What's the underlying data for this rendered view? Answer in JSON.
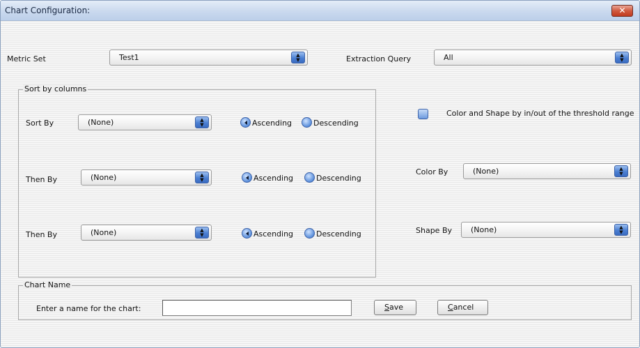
{
  "window": {
    "title": "Chart Configuration:",
    "close_icon": "close-icon"
  },
  "metric_set": {
    "label": "Metric Set",
    "value": "Test1"
  },
  "extraction_query": {
    "label": "Extraction Query",
    "value": "All"
  },
  "sort_group": {
    "legend": "Sort by columns",
    "rows": [
      {
        "label": "Sort By",
        "value": "(None)",
        "asc_label": "Ascending",
        "desc_label": "Descending",
        "selected": "Ascending"
      },
      {
        "label": "Then By",
        "value": "(None)",
        "asc_label": "Ascending",
        "desc_label": "Descending",
        "selected": "Ascending"
      },
      {
        "label": "Then By",
        "value": "(None)",
        "asc_label": "Ascending",
        "desc_label": "Descending",
        "selected": "Ascending"
      }
    ]
  },
  "threshold": {
    "label": "Color and Shape by in/out of the threshold range",
    "checked": false
  },
  "color_by": {
    "label": "Color By",
    "value": "(None)"
  },
  "shape_by": {
    "label": "Shape By",
    "value": "(None)"
  },
  "chart_name": {
    "legend": "Chart Name",
    "prompt": "Enter a name for the chart:",
    "value": "",
    "save_mnemonic": "S",
    "save_rest": "ave",
    "cancel_mnemonic": "C",
    "cancel_rest": "ancel"
  },
  "colors": {
    "titlebar": "#cad9ee",
    "close": "#c9442a",
    "accent": "#4b7fd2"
  }
}
